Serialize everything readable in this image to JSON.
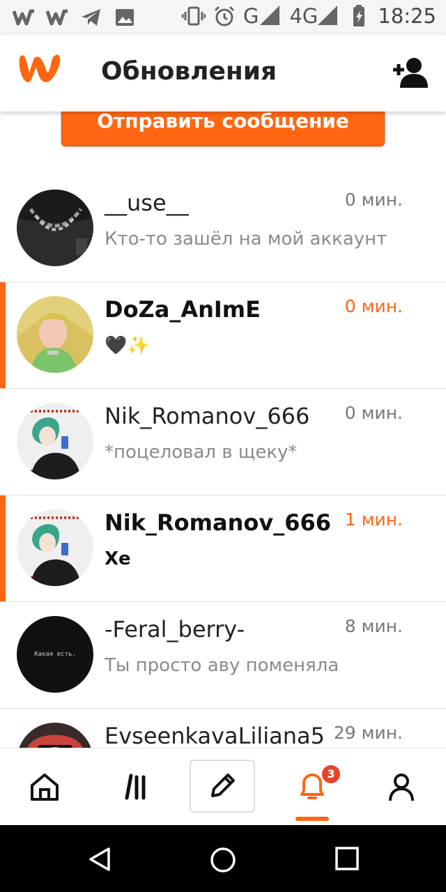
{
  "status_bar": {
    "time": "18:25",
    "network_g": "G",
    "network_4g": "4G",
    "network_4g_small": "4G",
    "left_icons": [
      "w-logo-icon",
      "w-logo-icon",
      "telegram-icon",
      "image-icon"
    ],
    "right_icons": [
      "vibrate-icon",
      "alarm-icon",
      "signal-icon",
      "battery-charging-icon"
    ]
  },
  "header": {
    "title": "Обновления",
    "add_user_icon": "add-user-icon",
    "brand_color": "#ff6611"
  },
  "send_message_button": {
    "label": "Отправить сообщение"
  },
  "conversations": [
    {
      "name": "__use__",
      "message": "Кто-то зашёл на мой аккаунт",
      "time": "0 мин.",
      "unread": false,
      "avatar": "avatar-chain"
    },
    {
      "name": "DoZa_AnImE",
      "message": "🖤✨",
      "time": "0 мин.",
      "unread": true,
      "avatar": "avatar-blonde"
    },
    {
      "name": "Nik_Romanov_666",
      "message": "*поцеловал в щеку*",
      "time": "0 мин.",
      "unread": false,
      "avatar": "avatar-anime"
    },
    {
      "name": "Nik_Romanov_666",
      "message": "Хе",
      "time": "1 мин.",
      "unread": true,
      "avatar": "avatar-anime"
    },
    {
      "name": "-Feral_berry-",
      "message": "Ты просто аву поменяла",
      "time": "8 мин.",
      "unread": false,
      "avatar": "avatar-black",
      "avatar_text": "Какая есть."
    },
    {
      "name": "EvseenkavaLiliana5",
      "message": "",
      "time": "29 мин.",
      "unread": false,
      "avatar": "avatar-red"
    }
  ],
  "bottom_nav": {
    "items": [
      "home-icon",
      "library-icon",
      "write-icon",
      "notifications-icon",
      "profile-icon"
    ],
    "notification_count": "3",
    "active": "notifications-icon"
  },
  "system_nav": {
    "items": [
      "back-icon",
      "home-circle-icon",
      "recents-icon"
    ]
  }
}
